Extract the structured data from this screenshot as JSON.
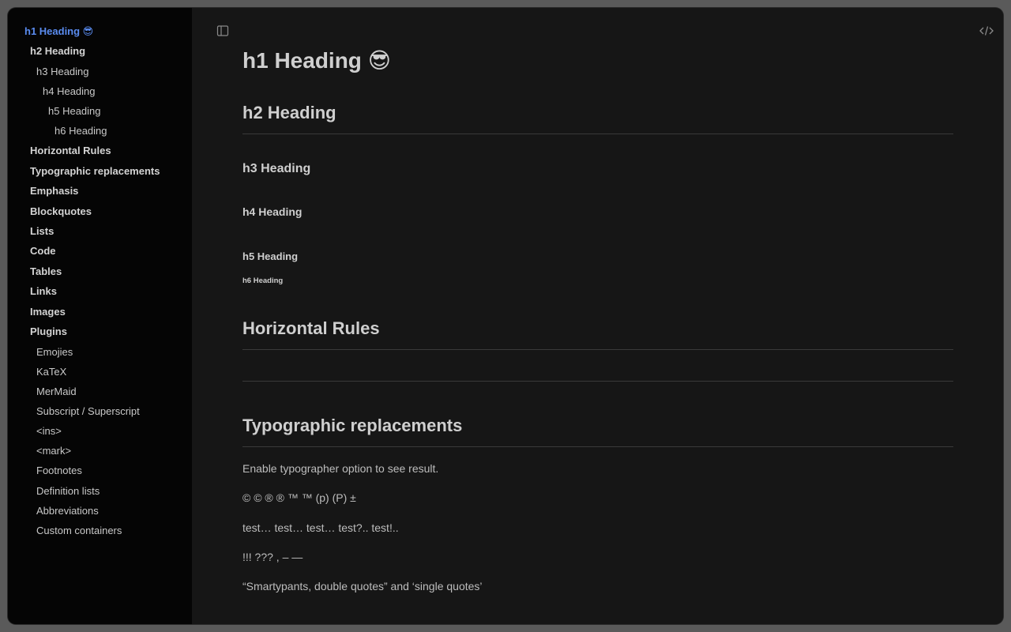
{
  "toc": [
    {
      "label": "h1 Heading 😎",
      "level": 1,
      "active": true
    },
    {
      "label": "h2 Heading",
      "level": 2
    },
    {
      "label": "h3 Heading",
      "level": 3
    },
    {
      "label": "h4 Heading",
      "level": 4
    },
    {
      "label": "h5 Heading",
      "level": 5
    },
    {
      "label": "h6 Heading",
      "level": 6
    },
    {
      "label": "Horizontal Rules",
      "level": 2
    },
    {
      "label": "Typographic replacements",
      "level": 2
    },
    {
      "label": "Emphasis",
      "level": 2
    },
    {
      "label": "Blockquotes",
      "level": 2
    },
    {
      "label": "Lists",
      "level": 2
    },
    {
      "label": "Code",
      "level": 2
    },
    {
      "label": "Tables",
      "level": 2
    },
    {
      "label": "Links",
      "level": 2
    },
    {
      "label": "Images",
      "level": 2
    },
    {
      "label": "Plugins",
      "level": 2
    },
    {
      "label": "Emojies",
      "level": 3
    },
    {
      "label": "KaTeX",
      "level": 3
    },
    {
      "label": "MerMaid",
      "level": 3
    },
    {
      "label": "Subscript / Superscript",
      "level": 3
    },
    {
      "label": "<ins>",
      "level": 3
    },
    {
      "label": "<mark>",
      "level": 3
    },
    {
      "label": "Footnotes",
      "level": 3
    },
    {
      "label": "Definition lists",
      "level": 3
    },
    {
      "label": "Abbreviations",
      "level": 3
    },
    {
      "label": "Custom containers",
      "level": 3
    }
  ],
  "toolbar": {
    "sidebar_toggle_icon": "sidebar-toggle-icon",
    "source_icon": "code-icon"
  },
  "content": {
    "h1": "h1 Heading 😎",
    "h2": "h2 Heading",
    "h3": "h3 Heading",
    "h4": "h4 Heading",
    "h5": "h5 Heading",
    "h6": "h6 Heading",
    "horizontal_rules": "Horizontal Rules",
    "typographic": "Typographic replacements",
    "paragraphs": [
      "Enable typographer option to see result.",
      "© © ® ® ™ ™ (p) (P) ±",
      "test… test… test… test?.. test!..",
      "!!! ??? , – —",
      "“Smartypants, double quotes” and ‘single quotes’"
    ]
  },
  "colors": {
    "accent": "#5a8cf0",
    "sidebar_bg": "#050505",
    "main_bg": "#161616"
  }
}
